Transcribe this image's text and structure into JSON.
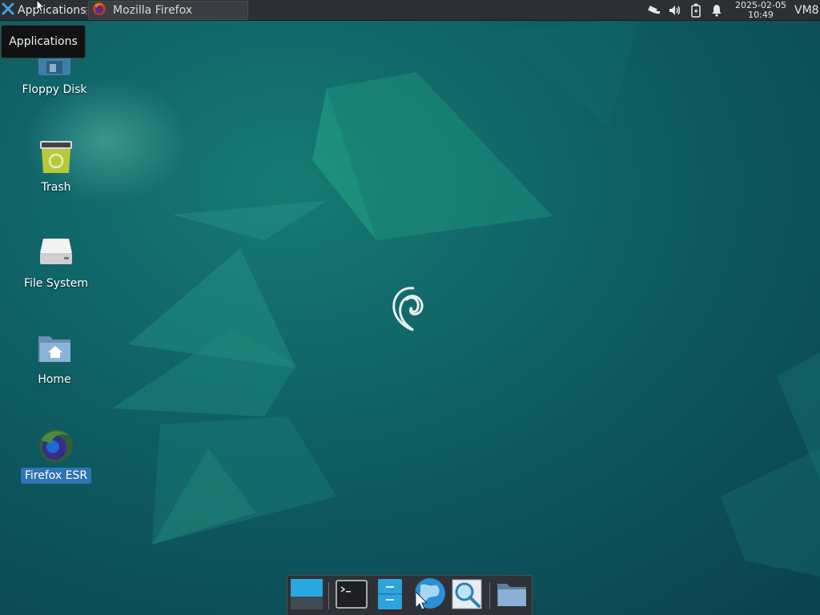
{
  "panel": {
    "apps_label": "Applications",
    "apps_separator": "⋮",
    "task_label": "Mozilla Firefox",
    "clock_date": "2025-02-05",
    "clock_time": "10:49",
    "vm_label": "VM8"
  },
  "tooltip": {
    "text": "Applications"
  },
  "desktop": {
    "icons": [
      {
        "label": "Floppy Disk",
        "icon": "floppy-disk-icon"
      },
      {
        "label": "Trash",
        "icon": "trash-icon"
      },
      {
        "label": "File System",
        "icon": "file-system-icon"
      },
      {
        "label": "Home",
        "icon": "home-folder-icon"
      },
      {
        "label": "Firefox ESR",
        "icon": "firefox-icon"
      }
    ]
  },
  "dock": {
    "items": [
      {
        "icon": "show-desktop-icon"
      },
      {
        "icon": "terminal-icon"
      },
      {
        "icon": "file-manager-icon"
      },
      {
        "icon": "web-browser-icon"
      },
      {
        "icon": "app-finder-icon"
      },
      {
        "icon": "folder-icon"
      }
    ]
  },
  "colors": {
    "panel_bg": "#2c2f33",
    "selection": "#2f74b3",
    "wallpaper_base": "#0d4f5a"
  }
}
